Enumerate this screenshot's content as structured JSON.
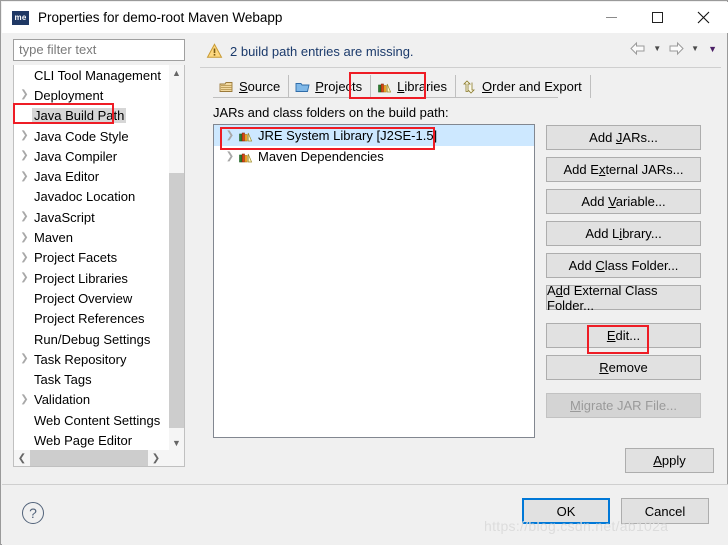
{
  "window": {
    "title": "Properties for demo-root Maven Webapp",
    "app_icon": "me",
    "minimize": "minimize-icon",
    "maximize": "maximize-icon",
    "close": "close-icon"
  },
  "filter": {
    "placeholder": "type filter text",
    "value": ""
  },
  "sidebar": {
    "items": [
      {
        "label": "CLI Tool Management",
        "expandable": false,
        "selected": false
      },
      {
        "label": "Deployment",
        "expandable": true,
        "selected": false
      },
      {
        "label": "Java Build Path",
        "expandable": false,
        "selected": true
      },
      {
        "label": "Java Code Style",
        "expandable": true,
        "selected": false
      },
      {
        "label": "Java Compiler",
        "expandable": true,
        "selected": false
      },
      {
        "label": "Java Editor",
        "expandable": true,
        "selected": false
      },
      {
        "label": "Javadoc Location",
        "expandable": false,
        "selected": false
      },
      {
        "label": "JavaScript",
        "expandable": true,
        "selected": false
      },
      {
        "label": "Maven",
        "expandable": true,
        "selected": false
      },
      {
        "label": "Project Facets",
        "expandable": true,
        "selected": false
      },
      {
        "label": "Project Libraries",
        "expandable": true,
        "selected": false
      },
      {
        "label": "Project Overview",
        "expandable": false,
        "selected": false
      },
      {
        "label": "Project References",
        "expandable": false,
        "selected": false
      },
      {
        "label": "Run/Debug Settings",
        "expandable": false,
        "selected": false
      },
      {
        "label": "Task Repository",
        "expandable": true,
        "selected": false
      },
      {
        "label": "Task Tags",
        "expandable": false,
        "selected": false
      },
      {
        "label": "Validation",
        "expandable": true,
        "selected": false
      },
      {
        "label": "Web Content Settings",
        "expandable": false,
        "selected": false
      },
      {
        "label": "Web Page Editor",
        "expandable": false,
        "selected": false
      }
    ]
  },
  "message": {
    "icon": "warning-icon",
    "text": "2 build path entries are missing."
  },
  "nav": {
    "back": "back-arrow-icon",
    "back_menu": "chevron-down-icon",
    "forward": "forward-arrow-icon",
    "forward_menu": "chevron-down-icon",
    "view_menu": "chevron-down-icon"
  },
  "tabs": [
    {
      "label": "Source",
      "mnemonic": "S",
      "icon": "source-folder-icon",
      "active": false
    },
    {
      "label": "Projects",
      "mnemonic": "P",
      "icon": "projects-folder-icon",
      "active": false
    },
    {
      "label": "Libraries",
      "mnemonic": "L",
      "icon": "libraries-books-icon",
      "active": true
    },
    {
      "label": "Order and Export",
      "mnemonic": "O",
      "icon": "order-export-icon",
      "active": false
    }
  ],
  "main": {
    "list_label": "JARs and class folders on the build path:",
    "entries": [
      {
        "label": "JRE System Library [J2SE-1.5]",
        "icon": "library-books-icon",
        "selected": true,
        "expandable": true
      },
      {
        "label": "Maven Dependencies",
        "icon": "library-books-icon",
        "selected": false,
        "expandable": true
      }
    ]
  },
  "buttons": {
    "right_column": [
      {
        "label": "Add JARs...",
        "mnemonic": "J",
        "disabled": false,
        "gap": false
      },
      {
        "label": "Add External JARs...",
        "mnemonic": "x",
        "disabled": false,
        "gap": false
      },
      {
        "label": "Add Variable...",
        "mnemonic": "V",
        "disabled": false,
        "gap": false
      },
      {
        "label": "Add Library...",
        "mnemonic": "i",
        "disabled": false,
        "gap": false
      },
      {
        "label": "Add Class Folder...",
        "mnemonic": "C",
        "disabled": false,
        "gap": false
      },
      {
        "label": "Add External Class Folder...",
        "mnemonic": "d",
        "disabled": false,
        "gap": false
      },
      {
        "label": "Edit...",
        "mnemonic": "E",
        "disabled": false,
        "gap": true
      },
      {
        "label": "Remove",
        "mnemonic": "R",
        "disabled": false,
        "gap": false
      },
      {
        "label": "Migrate JAR File...",
        "mnemonic": "M",
        "disabled": true,
        "gap": true
      }
    ],
    "apply": "Apply",
    "apply_mnemonic": "A",
    "ok": "OK",
    "cancel": "Cancel",
    "help": "?"
  },
  "watermark": "https://blog.csdn.net/ab102a",
  "colors": {
    "highlight_red": "#ee1c25",
    "selection_blue": "#cde8ff",
    "focus_blue": "#0078d7",
    "dialog_bg": "#f0f0f0"
  }
}
